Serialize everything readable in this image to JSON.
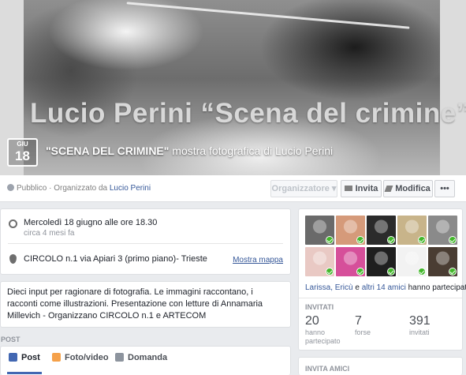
{
  "cover": {
    "title": "Lucio Perini “Scena del crimine”",
    "date_month": "GIU",
    "date_day": "18",
    "event_name_bold": "\"SCENA DEL CRIMINE\"",
    "event_name_rest": " mostra fotografica di Lucio Perini"
  },
  "action_bar": {
    "privacy_text": "Pubblico · Organizzato da ",
    "organizer": "Lucio Perini",
    "organizer_btn": "Organizzatore ▾",
    "invite_btn": "Invita",
    "edit_btn": "Modifica",
    "more_btn": "•••"
  },
  "info": {
    "when": "Mercoledì 18 giugno alle ore 18.30",
    "when_relative": "circa 4 mesi fa",
    "where": "CIRCOLO n.1 via Apiari 3 (primo piano)- Trieste",
    "map_link": "Mostra mappa"
  },
  "description": "Dieci input per ragionare di fotografia. Le immagini raccontano, i racconti come illustrazioni. Presentazione con letture di Annamaria Millevich - Organizzano CIRCOLO n.1 e ARTECOM",
  "composer": {
    "section_label": "POST",
    "tabs": [
      "Post",
      "Foto/video",
      "Domanda"
    ]
  },
  "guests": {
    "names": "Larissa, Ericù",
    "connector": " e ",
    "others": "altri 14 amici",
    "suffix": " hanno partecipato",
    "invited_title": "INVITATI",
    "stats": [
      {
        "value": "20",
        "label": "hanno partecipato"
      },
      {
        "value": "7",
        "label": "forse"
      },
      {
        "value": "391",
        "label": "invitati"
      }
    ],
    "invite_friends_title": "INVITA AMICI",
    "avatar_colors": [
      "#6a6a6a",
      "#d59a7a",
      "#2b2b2b",
      "#c8b48a",
      "#8a8a8a",
      "#e9c9c4",
      "#d64f9a",
      "#1f1f1f",
      "#f2f2f2",
      "#4a3d33"
    ]
  }
}
